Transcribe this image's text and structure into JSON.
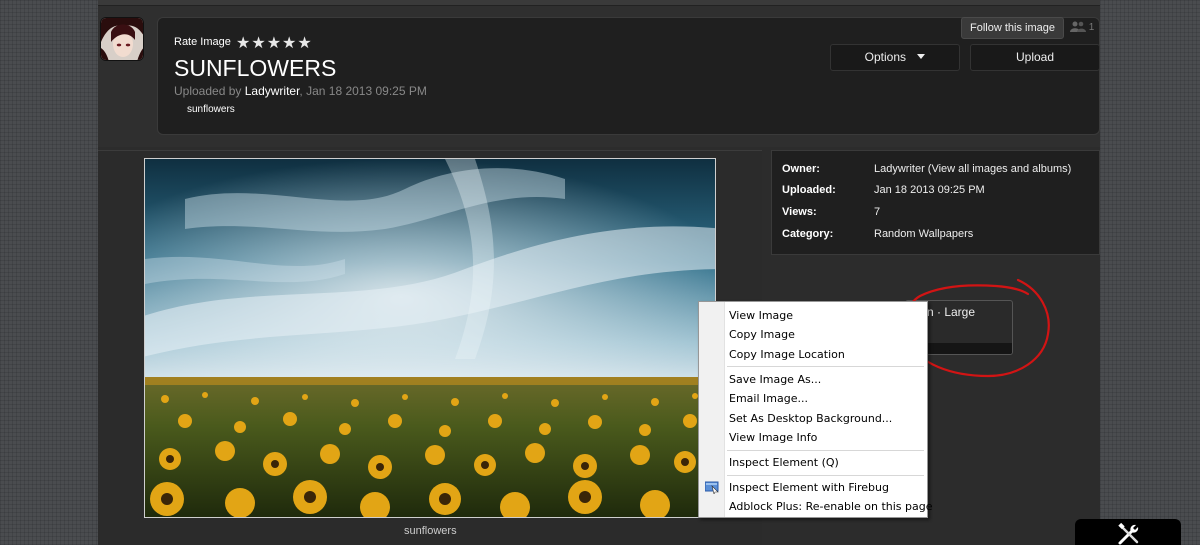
{
  "header": {
    "rate_label": "Rate Image",
    "stars": "★★★★★",
    "title": "SUNFLOWERS",
    "uploaded_prefix": "Uploaded by ",
    "uploader": "Ladywriter",
    "uploaded_suffix": ", Jan 18 2013 09:25 PM",
    "tag": "sunflowers",
    "follow_label": "Follow this image",
    "follow_count": "1",
    "options_label": "Options",
    "upload_label": "Upload"
  },
  "image": {
    "caption": "sunflowers"
  },
  "info": [
    {
      "key": "Owner:",
      "value": "Ladywriter (View all images and albums)"
    },
    {
      "key": "Uploaded:",
      "value": "Jan 18 2013 09:25 PM"
    },
    {
      "key": "Views:",
      "value": "7"
    },
    {
      "key": "Category:",
      "value": "Random Wallpapers"
    }
  ],
  "size_box": {
    "text": "n · Large"
  },
  "context_menu": {
    "items": [
      "View Image",
      "Copy Image",
      "Copy Image Location",
      "Save Image As...",
      "Email Image...",
      "Set As Desktop Background...",
      "View Image Info",
      "Inspect Element (Q)",
      "Inspect Element with Firebug",
      "Adblock Plus: Re-enable on this page"
    ]
  },
  "colors": {
    "accent_red": "#d21414",
    "panel_dark": "#1f1f1f",
    "page_bg": "#2c2c2c"
  },
  "icons": {
    "stars": "star-icon",
    "options": "caret-down-icon",
    "follow": "people-icon",
    "firebug": "firebug-icon",
    "tools": "tools-icon"
  }
}
